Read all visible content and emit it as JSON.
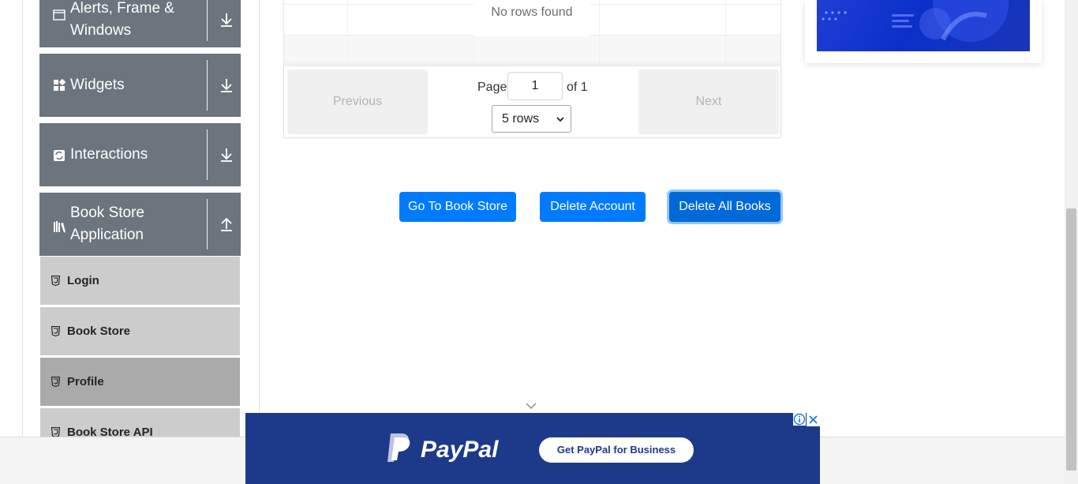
{
  "sidebar": {
    "groups": [
      {
        "label": "Alerts, Frame & Windows",
        "icon": "window-icon",
        "toggle": "download-arrow-icon"
      },
      {
        "label": "Widgets",
        "icon": "widgets-icon",
        "toggle": "download-arrow-icon"
      },
      {
        "label": "Interactions",
        "icon": "interactions-icon",
        "toggle": "download-arrow-icon"
      },
      {
        "label": "Book Store Application",
        "icon": "books-icon",
        "toggle": "upload-arrow-icon"
      }
    ],
    "items": [
      {
        "label": "Login",
        "icon": "html5-icon",
        "active": false
      },
      {
        "label": "Book Store",
        "icon": "html5-icon",
        "active": false
      },
      {
        "label": "Profile",
        "icon": "html5-icon",
        "active": true
      },
      {
        "label": "Book Store API",
        "icon": "html5-icon",
        "active": false
      }
    ]
  },
  "table": {
    "empty_message": "No rows found",
    "pagination": {
      "previous_label": "Previous",
      "next_label": "Next",
      "page_label": "Page",
      "page_value": "1",
      "of_label": "of 1",
      "rows_select": "5 rows"
    }
  },
  "actions": {
    "go_to_store": "Go To Book Store",
    "delete_account": "Delete Account",
    "delete_all_books": "Delete All Books"
  },
  "ad": {
    "brand": "PayPal",
    "cta": "Get PayPal for Business"
  },
  "colors": {
    "primary": "#007bff",
    "sidebar_header": "#6c757d",
    "menu_item": "#cccccc",
    "menu_item_active": "#aaaaaa",
    "ad_background": "#1d3a8a"
  }
}
